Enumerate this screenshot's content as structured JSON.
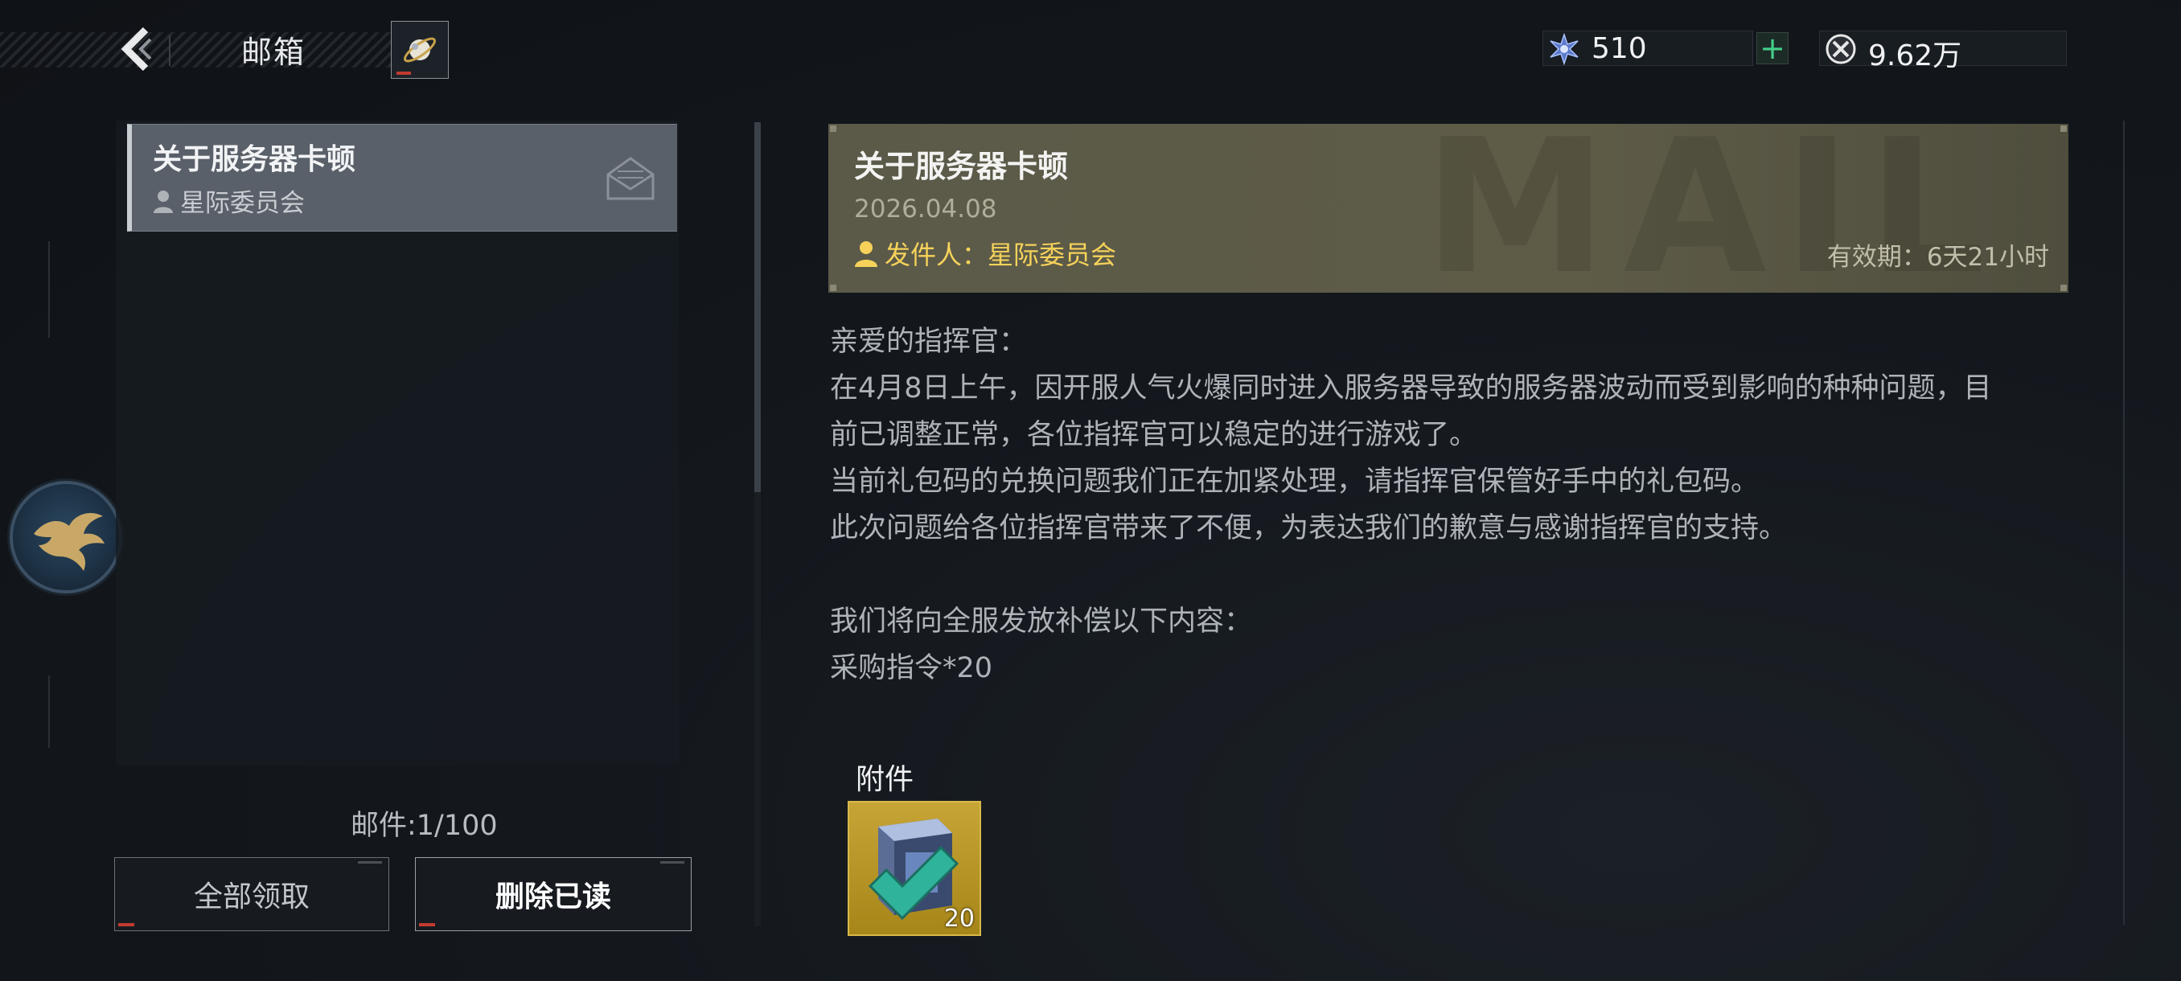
{
  "header": {
    "title": "邮箱",
    "currency_gems": "510",
    "currency_plus": "+",
    "currency_coins": "9.62万"
  },
  "mail_list": {
    "items": [
      {
        "title": "关于服务器卡顿",
        "sender": "星际委员会"
      }
    ],
    "count_label": "邮件:1/100",
    "claim_all_label": "全部领取",
    "delete_read_label": "删除已读"
  },
  "mail_detail": {
    "title": "关于服务器卡顿",
    "date": "2026.04.08",
    "sender_label": "发件人：星际委员会",
    "expire_label": "有效期：6天21小时",
    "watermark": "MAIL",
    "body": [
      "亲爱的指挥官：",
      "在4月8日上午，因开服人气火爆同时进入服务器导致的服务器波动而受到影响的种种问题，目",
      "前已调整正常，各位指挥官可以稳定的进行游戏了。",
      "当前礼包码的兑换问题我们正在加紧处理，请指挥官保管好手中的礼包码。",
      "此次问题给各位指挥官带来了不便，为表达我们的歉意与感谢指挥官的支持。",
      "",
      "我们将向全服发放补偿以下内容：",
      "采购指令*20"
    ],
    "attachment_label": "附件",
    "attachment_count": "20"
  }
}
